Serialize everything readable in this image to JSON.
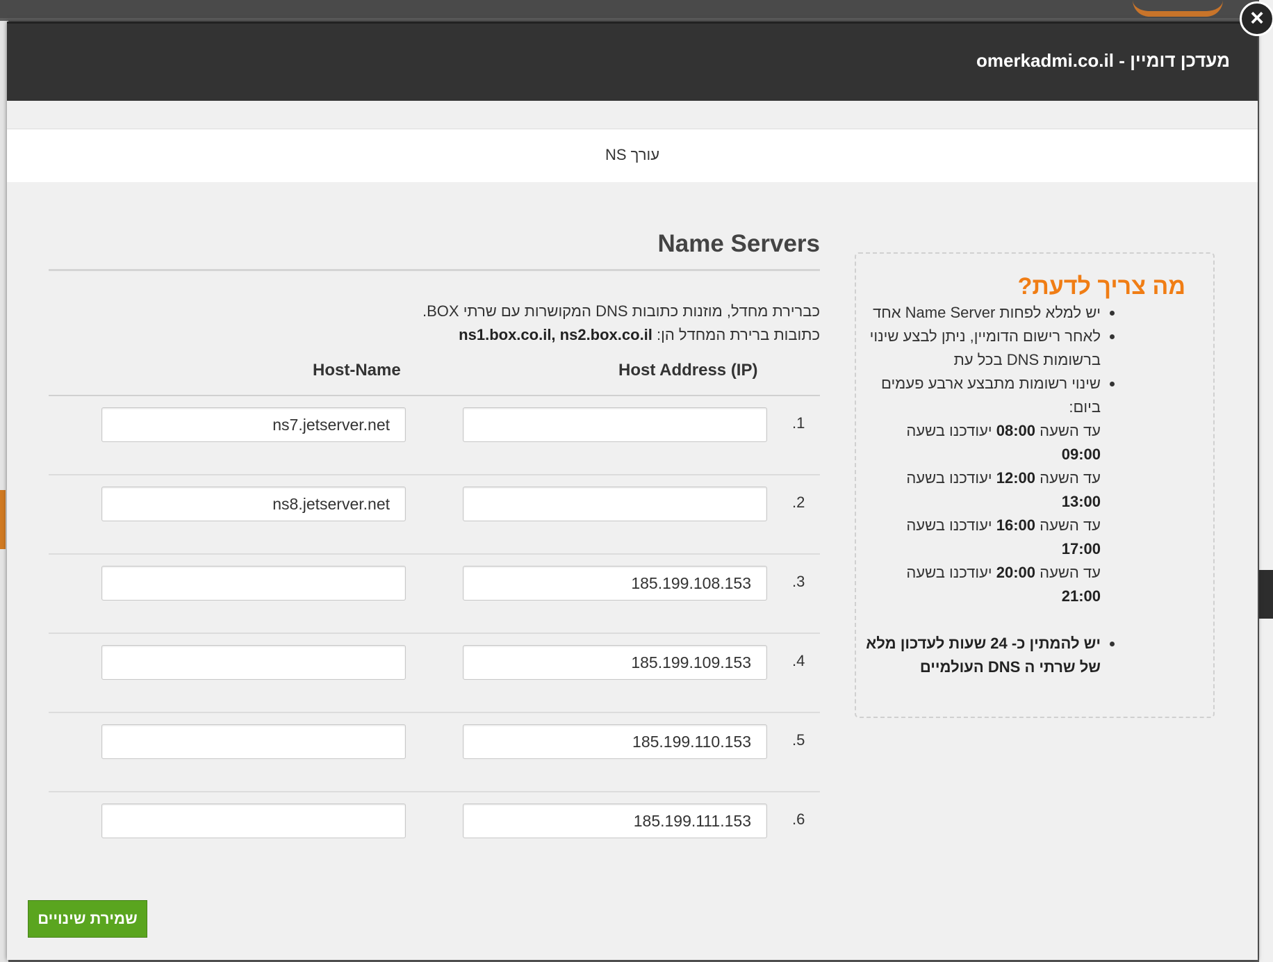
{
  "modal": {
    "title": "מעדכן דומיין - omerkadmi.co.il",
    "close_label": "×",
    "tab_label": "עורך NS"
  },
  "info": {
    "title": "מה צריך לדעת?",
    "items": [
      "יש למלא לפחות Name Server אחד",
      "לאחר רישום הדומיין, ניתן לבצע שינוי ברשומות DNS בכל עת",
      "שינוי רשומות מתבצע ארבע פעמים ביום:"
    ],
    "schedule": [
      {
        "prefix": "עד השעה",
        "until": "08:00",
        "middle": "יעודכנו בשעה",
        "at": "09:00"
      },
      {
        "prefix": "עד השעה",
        "until": "12:00",
        "middle": "יעודכנו בשעה",
        "at": "13:00"
      },
      {
        "prefix": "עד השעה",
        "until": "16:00",
        "middle": "יעודכנו בשעה",
        "at": "17:00"
      },
      {
        "prefix": "עד השעה",
        "until": "20:00",
        "middle": "יעודכנו בשעה",
        "at": "21:00"
      }
    ],
    "last_item": "יש להמתין כ- 24 שעות לעדכון מלא של שרתי ה DNS העולמיים"
  },
  "ns": {
    "title": "Name Servers",
    "desc1": "כברירת מחדל, מוזנות כתובות DNS המקושרות עם שרתי BOX.",
    "desc2_prefix": "כתובות ברירת המחדל הן: ",
    "desc2_values": "ns1.box.co.il, ns2.box.co.il",
    "col_ip": "Host Address (IP)",
    "col_host": "Host-Name",
    "rows": [
      {
        "num": ".1",
        "ip": "",
        "host": "ns7.jetserver.net"
      },
      {
        "num": ".2",
        "ip": "",
        "host": "ns8.jetserver.net"
      },
      {
        "num": ".3",
        "ip": "185.199.108.153",
        "host": ""
      },
      {
        "num": ".4",
        "ip": "185.199.109.153",
        "host": ""
      },
      {
        "num": ".5",
        "ip": "185.199.110.153",
        "host": ""
      },
      {
        "num": ".6",
        "ip": "185.199.111.153",
        "host": ""
      }
    ]
  },
  "save_label": "שמירת שינויים"
}
